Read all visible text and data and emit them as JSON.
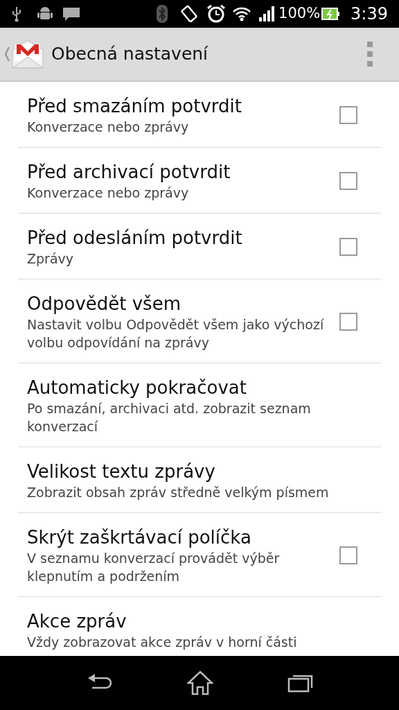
{
  "status_bar": {
    "battery": "100%",
    "time": "3:39"
  },
  "action_bar": {
    "title": "Obecná nastavení"
  },
  "settings": [
    {
      "kind": "checkbox",
      "title": "Před smazáním potvrdit",
      "summary": "Konverzace nebo zprávy",
      "checked": false
    },
    {
      "kind": "checkbox",
      "title": "Před archivací potvrdit",
      "summary": "Konverzace nebo zprávy",
      "checked": false
    },
    {
      "kind": "checkbox",
      "title": "Před odesláním potvrdit",
      "summary": "Zprávy",
      "checked": false
    },
    {
      "kind": "checkbox",
      "title": "Odpovědět všem",
      "summary": "Nastavit volbu Odpovědět všem jako výchozí volbu odpovídání na zprávy",
      "checked": false
    },
    {
      "kind": "plain",
      "title": "Automaticky pokračovat",
      "summary": "Po smazání, archivaci atd. zobrazit seznam konverzací"
    },
    {
      "kind": "plain",
      "title": "Velikost textu zprávy",
      "summary": "Zobrazit obsah zpráv středně velkým písmem"
    },
    {
      "kind": "checkbox",
      "title": "Skrýt zaškrtávací políčka",
      "summary": "V seznamu konverzací provádět výběr klepnutím a podržením",
      "checked": false
    },
    {
      "kind": "plain",
      "title": "Akce zpráv",
      "summary": "Vždy zobrazovat akce zpráv v horní části"
    }
  ]
}
